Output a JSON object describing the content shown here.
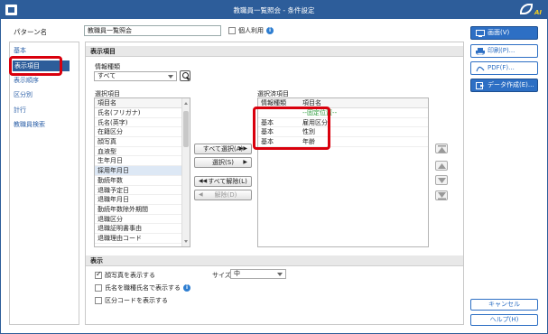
{
  "window": {
    "title": "教職員一覧照会 - 条件設定",
    "brand": "AI"
  },
  "pattern": {
    "label": "パターン名",
    "value": "教職員一覧照会",
    "personal_label": "個人利用",
    "info_icon": "info-icon"
  },
  "sidebar": {
    "items": [
      {
        "label": "基本"
      },
      {
        "label": "表示項目"
      },
      {
        "label": "表示順序"
      },
      {
        "label": "区分別"
      },
      {
        "label": "計行"
      },
      {
        "label": "教職員検索"
      }
    ]
  },
  "display_items": {
    "header": "表示項目",
    "info_type_label": "情報種類",
    "info_type_value": "すべて",
    "select_items_label": "選択項目",
    "select_items_header": "項目名",
    "select_items": [
      "氏名(フリガナ)",
      "氏名(英字)",
      "在籍区分",
      "顔写真",
      "血液型",
      "生年月日",
      "採用年月日",
      "勤続年数",
      "退職予定日",
      "退職年月日",
      "勤続年数除外期間",
      "退職区分",
      "退職証明書事由",
      "退職理由コード"
    ],
    "selected_index": 6,
    "buttons": {
      "select_all": "すべて選択(A)",
      "select": "選択(S)",
      "deselect_all": "すべて解除(L)",
      "deselect": "解除(D)"
    },
    "chosen_label": "選択済項目",
    "chosen_header_type": "情報種類",
    "chosen_header_name": "項目名",
    "chosen_fixed": "--固定位置--",
    "chosen_items": [
      {
        "type": "基本",
        "name": "雇用区分"
      },
      {
        "type": "基本",
        "name": "性別"
      },
      {
        "type": "基本",
        "name": "年齢"
      }
    ]
  },
  "display": {
    "header": "表示",
    "show_photo_label": "顔写真を表示する",
    "show_photo_checked": true,
    "size_label": "サイズ",
    "size_value": "中",
    "show_job_title_label": "氏名を職種氏名で表示する",
    "show_code_label": "区分コードを表示する"
  },
  "actions": {
    "screen": "画面(V)",
    "print": "印刷(P)...",
    "pdf": "PDF(F)...",
    "data_create": "データ作成(E)...",
    "cancel": "キャンセル",
    "help": "ヘルプ(H)"
  },
  "colors": {
    "titlebar": "#2d5d9a",
    "accent": "#2d6fc4",
    "highlight": "#d9000d",
    "fixed": "#2a9a3a"
  }
}
